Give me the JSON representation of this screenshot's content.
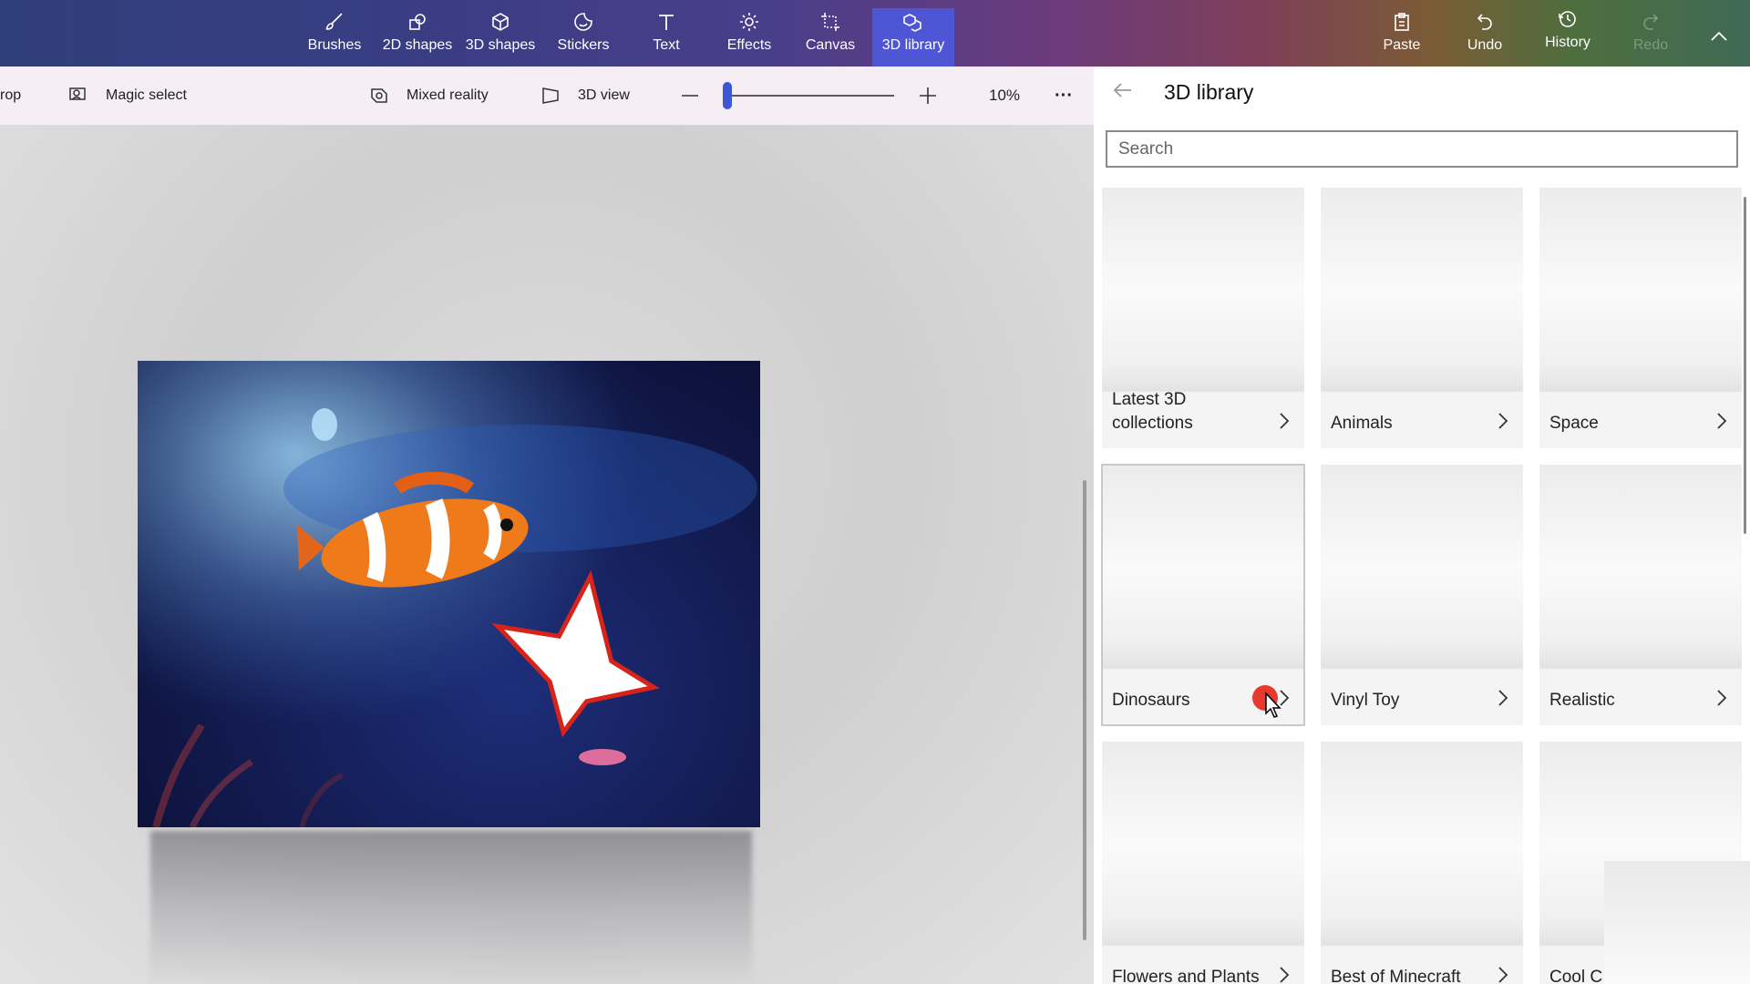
{
  "ribbon": {
    "tools": [
      {
        "label": "Brushes",
        "icon": "brush-icon"
      },
      {
        "label": "2D shapes",
        "icon": "2d-shapes-icon"
      },
      {
        "label": "3D shapes",
        "icon": "3d-shapes-icon"
      },
      {
        "label": "Stickers",
        "icon": "stickers-icon"
      },
      {
        "label": "Text",
        "icon": "text-icon"
      },
      {
        "label": "Effects",
        "icon": "effects-icon"
      },
      {
        "label": "Canvas",
        "icon": "canvas-icon"
      },
      {
        "label": "3D library",
        "icon": "3d-library-icon",
        "active": true
      }
    ],
    "actions": [
      {
        "label": "Paste",
        "icon": "paste-icon"
      },
      {
        "label": "Undo",
        "icon": "undo-icon"
      },
      {
        "label": "History",
        "icon": "history-icon"
      },
      {
        "label": "Redo",
        "icon": "redo-icon",
        "disabled": true
      }
    ],
    "accent_color": "#4f56d6"
  },
  "subbar": {
    "crop_label": "rop",
    "magic_select_label": "Magic select",
    "mixed_reality_label": "Mixed reality",
    "view_3d_label": "3D view",
    "zoom_value": "10%",
    "zoom_fraction": 0.03,
    "more_label": "···"
  },
  "panel": {
    "title": "3D library",
    "search_placeholder": "Search",
    "categories": [
      {
        "label": "Latest 3D collections"
      },
      {
        "label": "Animals"
      },
      {
        "label": "Space"
      },
      {
        "label": "Dinosaurs",
        "selected": true
      },
      {
        "label": "Vinyl Toy"
      },
      {
        "label": "Realistic"
      },
      {
        "label": "Flowers and Plants"
      },
      {
        "label": "Best of Minecraft"
      },
      {
        "label": "Cool C"
      }
    ]
  }
}
